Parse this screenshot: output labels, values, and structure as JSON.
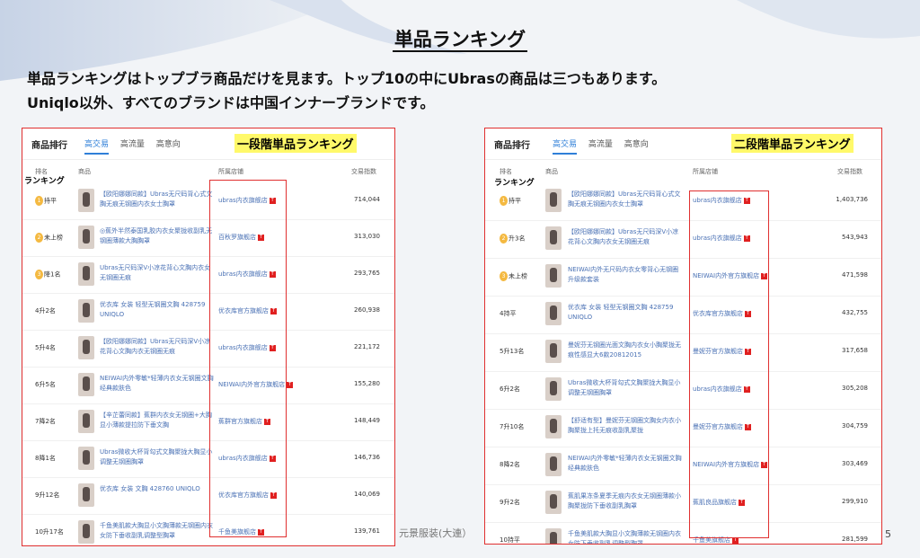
{
  "slide": {
    "title": "単品ランキング",
    "desc_line1": "単品ランキングはトップブラ商品だけを見ます。トップ10の中にUbrasの商品は三つもあります。",
    "desc_line2": "Uniqlo以外、すべてのブランドは中国インナーブランドです。",
    "footer": "元景服装(大連）",
    "page": "5"
  },
  "left": {
    "header": "商品排行",
    "tabs": [
      "高交易",
      "高流量",
      "高意向"
    ],
    "active_tab": 0,
    "stage": "一段階単品ランキング",
    "cols": [
      "排名",
      "商品",
      "所属店铺",
      "交易指数"
    ],
    "rank_word": "ランキング",
    "rows": [
      {
        "rank": "持平",
        "medal": "1",
        "name": "【欧阳娜娜同款】Ubras无尺码背心式文胸无痕无钢圈内衣女士胸罩",
        "store": "ubras内衣旗舰店",
        "value": "714,044"
      },
      {
        "rank": "未上榜",
        "medal": "2",
        "name": "◎蕉外半然泰国乳胶内衣女聚拢收副乳无钢圈薄款大胸胸罩",
        "store": "百秋罗旗舰店",
        "value": "313,030"
      },
      {
        "rank": "降1名",
        "medal": "3",
        "name": "Ubras无尺码深V小凉花背心文胸内衣女无钢圈无痕",
        "store": "ubras内衣旗舰店",
        "value": "293,765"
      },
      {
        "rank": "4升2名",
        "medal": "",
        "name": "优衣库 女装 轻型无钢圈文胸 428759 UNIQLO",
        "store": "优衣库官方旗舰店",
        "value": "260,938"
      },
      {
        "rank": "5升4名",
        "medal": "",
        "name": "【欧阳娜娜同款】Ubras无尺码深V小凉花背心文胸内衣无钢圈无痕",
        "store": "ubras内衣旗舰店",
        "value": "221,172"
      },
      {
        "rank": "6升5名",
        "medal": "",
        "name": "NEIWAI内外零敏*轻薄内衣女无钢圈文胸经典款肤色",
        "store": "NEIWAI内外官方旗舰店",
        "value": "155,280"
      },
      {
        "rank": "7降2名",
        "medal": "",
        "name": "【辛芷蕾同款】蕉群内衣女无钢圈+大胸显小薄款提拉防下垂文胸",
        "store": "蕉群官方旗舰店",
        "value": "148,449"
      },
      {
        "rank": "8降1名",
        "medal": "",
        "name": "Ubras微收大杯背勾式文胸聚拢大胸显小调整无钢圈胸罩",
        "store": "ubras内衣旗舰店",
        "value": "146,736"
      },
      {
        "rank": "9升12名",
        "medal": "",
        "name": "优衣库 女装 文胸 428760 UNIQLO",
        "store": "优衣库官方旗舰店",
        "value": "140,069"
      },
      {
        "rank": "10升17名",
        "medal": "",
        "name": "千鱼美肌款大胸显小文胸薄款无钢圈内衣女防下垂收副乳调整型胸罩",
        "store": "千鱼美旗舰店",
        "value": "139,761"
      }
    ]
  },
  "right": {
    "header": "商品排行",
    "tabs": [
      "高交易",
      "高流量",
      "高意向"
    ],
    "active_tab": 0,
    "stage": "二段階単品ランキング",
    "cols": [
      "排名",
      "商品",
      "所属店铺",
      "交易指数"
    ],
    "rank_word": "ランキング",
    "rows": [
      {
        "rank": "持平",
        "medal": "1",
        "name": "【欧阳娜娜同款】Ubras无尺码背心式文胸无痕无钢圈内衣女士胸罩",
        "store": "ubras内衣旗舰店",
        "value": "1,403,736"
      },
      {
        "rank": "升3名",
        "medal": "2",
        "name": "【欧阳娜娜同款】Ubras无尺码深V小凉花背心文胸内衣女无钢圈无痕",
        "store": "ubras内衣旗舰店",
        "value": "543,943"
      },
      {
        "rank": "未上榜",
        "medal": "3",
        "name": "NEIWAI内外无尺码内衣女零背心无钢圈升级款套装",
        "store": "NEIWAI内外官方旗舰店",
        "value": "471,598"
      },
      {
        "rank": "4持平",
        "medal": "",
        "name": "优衣库 女装 轻型无钢圈文胸 428759 UNIQLO",
        "store": "优衣库官方旗舰店",
        "value": "432,755"
      },
      {
        "rank": "5升13名",
        "medal": "",
        "name": "曼妮芬无钢圈光面文胸内衣女小胸聚拢无痕性感显大6款20812015",
        "store": "曼妮芬官方旗舰店",
        "value": "317,658"
      },
      {
        "rank": "6升2名",
        "medal": "",
        "name": "Ubras微收大杯背勾式文胸聚拢大胸显小调整无钢圈胸罩",
        "store": "ubras内衣旗舰店",
        "value": "305,208"
      },
      {
        "rank": "7升10名",
        "medal": "",
        "name": "【舒适有型】曼妮芬无钢圈文胸女内衣小胸聚拢上托无痕收副乳聚拢",
        "store": "曼妮芬官方旗舰店",
        "value": "304,759"
      },
      {
        "rank": "8降2名",
        "medal": "",
        "name": "NEIWAI内外零敏*轻薄内衣女无钢圈文胸经典款肤色",
        "store": "NEIWAI内外官方旗舰店",
        "value": "303,469"
      },
      {
        "rank": "9升2名",
        "medal": "",
        "name": "蕉肌果冻条夏季无痕内衣女无钢圈薄款小胸聚拢防下垂收副乳胸罩",
        "store": "蕉肌良品旗舰店",
        "value": "299,910"
      },
      {
        "rank": "10持平",
        "medal": "",
        "name": "千鱼美肌款大胸显小文胸薄款无钢圈内衣女防下垂收副乳调整型胸罩",
        "store": "千鱼美旗舰店",
        "value": "281,599"
      }
    ]
  }
}
